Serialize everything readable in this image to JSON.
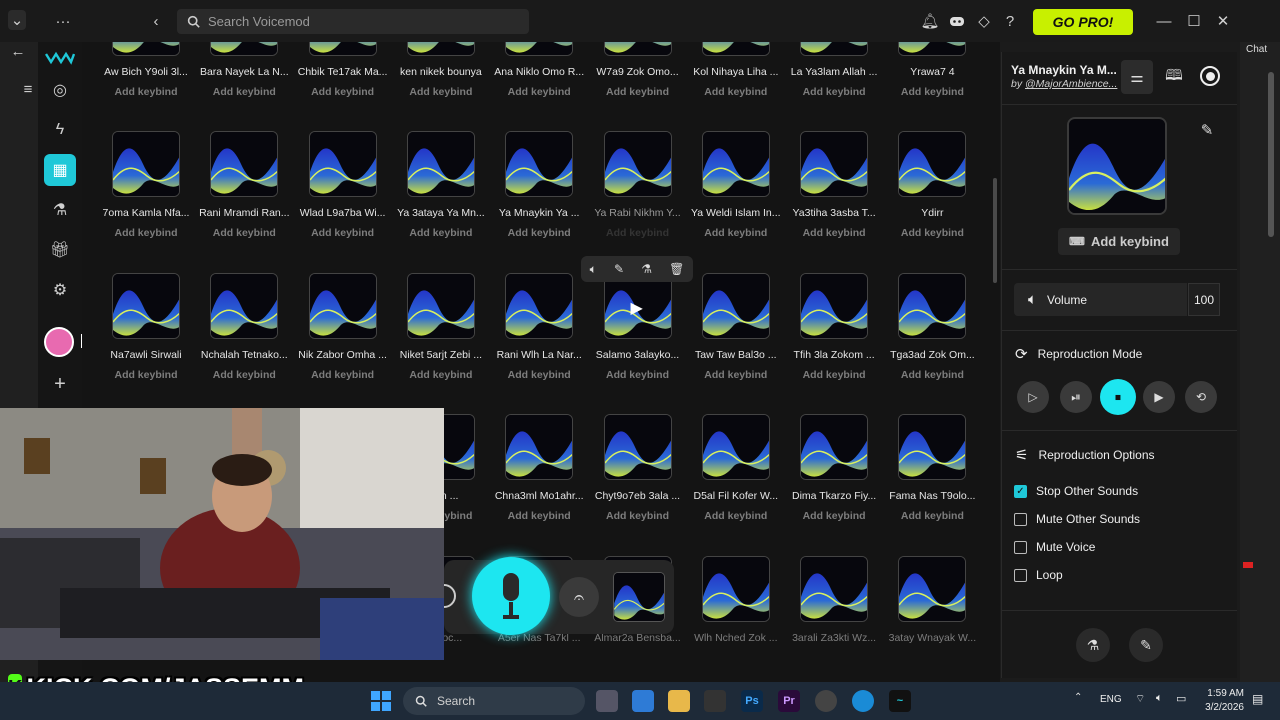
{
  "titlebar": {
    "search_placeholder": "Search Voicemod",
    "go_pro": "GO PRO!"
  },
  "browser_side": {
    "chat_label": "Chat"
  },
  "grid": {
    "tiles": [
      {
        "name": "Aw Bich Y9oli 3l...",
        "key": "Add keybind"
      },
      {
        "name": "Bara Nayek La N...",
        "key": "Add keybind"
      },
      {
        "name": "Chbik Te17ak Ma...",
        "key": "Add keybind"
      },
      {
        "name": "ken nikek bounya",
        "key": "Add keybind"
      },
      {
        "name": "Ana Niklo Omo R...",
        "key": "Add keybind"
      },
      {
        "name": "W7a9 Zok Omo...",
        "key": "Add keybind"
      },
      {
        "name": "Kol Nihaya Liha ...",
        "key": "Add keybind"
      },
      {
        "name": "La Ya3lam Allah ...",
        "key": "Add keybind"
      },
      {
        "name": "Yrawa7 4",
        "key": "Add keybind"
      },
      {
        "name": "7oma Kamla Nfa...",
        "key": "Add keybind"
      },
      {
        "name": "Rani Mramdi Ran...",
        "key": "Add keybind"
      },
      {
        "name": "Wlad L9a7ba Wi...",
        "key": "Add keybind"
      },
      {
        "name": "Ya 3ataya Ya Mn...",
        "key": "Add keybind"
      },
      {
        "name": "Ya Mnaykin Ya ...",
        "key": "Add keybind"
      },
      {
        "name": "Ya Rabi Nikhm Y...",
        "key": "Add keybind"
      },
      {
        "name": "Ya Weldi Islam In...",
        "key": "Add keybind"
      },
      {
        "name": "Ya3tiha 3asba T...",
        "key": "Add keybind"
      },
      {
        "name": "Ydirr",
        "key": "Add keybind"
      },
      {
        "name": "Na7awli Sirwali",
        "key": "Add keybind"
      },
      {
        "name": "Nchalah Tetnako...",
        "key": "Add keybind"
      },
      {
        "name": "Nik Zabor Omha ...",
        "key": "Add keybind"
      },
      {
        "name": "Niket 5arjt Zebi ...",
        "key": "Add keybind"
      },
      {
        "name": "Rani Wlh La Nar...",
        "key": "Add keybind"
      },
      {
        "name": "Salamo 3alayko...",
        "key": "Add keybind"
      },
      {
        "name": "Taw Taw Bal3o ...",
        "key": "Add keybind"
      },
      {
        "name": "Tfih 3la Zokom ...",
        "key": "Add keybind"
      },
      {
        "name": "Tga3ad Zok Om...",
        "key": "Add keybind"
      },
      {
        "name": "",
        "key": ""
      },
      {
        "name": "",
        "key": ""
      },
      {
        "name": "",
        "key": ""
      },
      {
        "name": "boun ...",
        "key": "Add keybind"
      },
      {
        "name": "Chna3ml Mo1ahr...",
        "key": "Add keybind"
      },
      {
        "name": "Chyt9o7eb 3ala ...",
        "key": "Add keybind"
      },
      {
        "name": "D5al Fil Kofer W...",
        "key": "Add keybind"
      },
      {
        "name": "Dima Tkarzo Fiy...",
        "key": "Add keybind"
      },
      {
        "name": "Fama Nas T9olo...",
        "key": "Add keybind"
      },
      {
        "name": "",
        "key": ""
      },
      {
        "name": "",
        "key": ""
      },
      {
        "name": "",
        "key": ""
      },
      {
        "name": "...bjboc...",
        "key": ""
      },
      {
        "name": "A5er Nas Ta7kl ...",
        "key": ""
      },
      {
        "name": "Almar2a Bensba...",
        "key": ""
      },
      {
        "name": "Wlh Nched Zok ...",
        "key": ""
      },
      {
        "name": "3arali Za3kti Wz...",
        "key": ""
      },
      {
        "name": "3atay Wnayak W...",
        "key": ""
      }
    ]
  },
  "panel": {
    "title": "Ya Mnaykin Ya M...",
    "author_prefix": "by ",
    "author": "@MajorAmbience...",
    "add_keybind": "Add keybind",
    "volume_label": "Volume",
    "volume_value": "100",
    "mode_label": "Reproduction Mode",
    "options_label": "Reproduction Options",
    "options": [
      {
        "label": "Stop Other Sounds",
        "checked": true
      },
      {
        "label": "Mute Other Sounds",
        "checked": false
      },
      {
        "label": "Mute Voice",
        "checked": false
      },
      {
        "label": "Loop",
        "checked": false
      }
    ]
  },
  "overlay": {
    "kick_text": "KICK.COM/JASSEMM",
    "kick_logo": "K"
  },
  "taskbar": {
    "search": "Search",
    "lang": "ENG",
    "time": "1:59 AM",
    "date": "3/2/2026",
    "apps": [
      "Ps",
      "Pr"
    ]
  }
}
